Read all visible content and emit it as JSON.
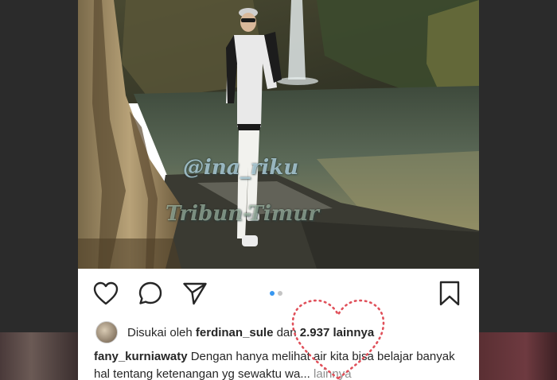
{
  "post": {
    "watermark_handle": "@ina_riku",
    "watermark_brand": "Tribun-Timur"
  },
  "actions": {
    "like_icon": "heart-outline-icon",
    "comment_icon": "comment-bubble-icon",
    "share_icon": "paper-plane-icon",
    "save_icon": "bookmark-icon",
    "carousel_count": 2,
    "carousel_active_index": 0,
    "accent_color": "#3897f0"
  },
  "likes": {
    "prefix": "Disukai oleh ",
    "user": "ferdinan_sule",
    "middle": " dan ",
    "count": "2.937 lainnya"
  },
  "caption": {
    "username": "fany_kurniawaty",
    "text": " Dengan hanya melihat air kita bisa belajar banyak hal tentang ketenangan yg sewaktu wa...",
    "more": " lainnya"
  },
  "overlay": {
    "heart_color": "#e0505a"
  }
}
